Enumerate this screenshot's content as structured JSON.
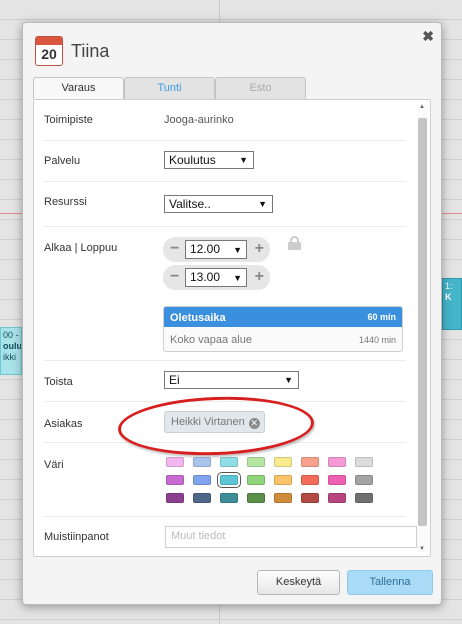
{
  "background": {
    "event_left_lines": [
      "00 -",
      "oulut",
      "ikki"
    ],
    "event_right_lines": [
      "1:",
      "K"
    ]
  },
  "dialog": {
    "title": "Tiina",
    "calendar_day": "20",
    "close_label": "✖",
    "tabs": [
      {
        "label": "Varaus",
        "state": "active"
      },
      {
        "label": "Tunti",
        "state": "link"
      },
      {
        "label": "Esto",
        "state": "disabled"
      }
    ],
    "fields": {
      "toimipiste": {
        "label": "Toimipiste",
        "value": "Jooga-aurinko"
      },
      "palvelu": {
        "label": "Palvelu",
        "value": "Koulutus"
      },
      "resurssi": {
        "label": "Resurssi",
        "value": "Valitse.."
      },
      "alkaa": {
        "label": "Alkaa | Loppuu",
        "start": "12.00",
        "end": "13.00"
      },
      "durations": [
        {
          "name": "Oletusaika",
          "value": "60 min",
          "selected": true
        },
        {
          "name": "Koko vapaa alue",
          "value": "1440 min",
          "selected": false
        }
      ],
      "toista": {
        "label": "Toista",
        "value": "Ei"
      },
      "asiakas": {
        "label": "Asiakas",
        "chip": "Heikki Virtanen"
      },
      "vari": {
        "label": "Väri"
      },
      "muistiinpanot": {
        "label": "Muistiinpanot",
        "placeholder": "Muut tiedot"
      }
    },
    "colors": {
      "accent": "#3a8fde",
      "annotation": "#d81f1f",
      "swatches": [
        "#f4b6f0",
        "#a9c4ec",
        "#8fdee5",
        "#b5e6a2",
        "#fbeb8f",
        "#f8a28b",
        "#f59ad6",
        "#dcdcdc",
        "#c86ad0",
        "#7fa3ec",
        "#5bc7d6",
        "#8fd37a",
        "#fbc468",
        "#f26c5a",
        "#ee5fb4",
        "#a3a3a3",
        "#8d3f8f",
        "#4e6789",
        "#3d8d98",
        "#5a8f48",
        "#cf8a3a",
        "#b34b42",
        "#b8457f",
        "#707070"
      ],
      "selected_swatch_index": 10
    },
    "buttons": {
      "cancel": "Keskeytä",
      "save": "Tallenna"
    }
  }
}
